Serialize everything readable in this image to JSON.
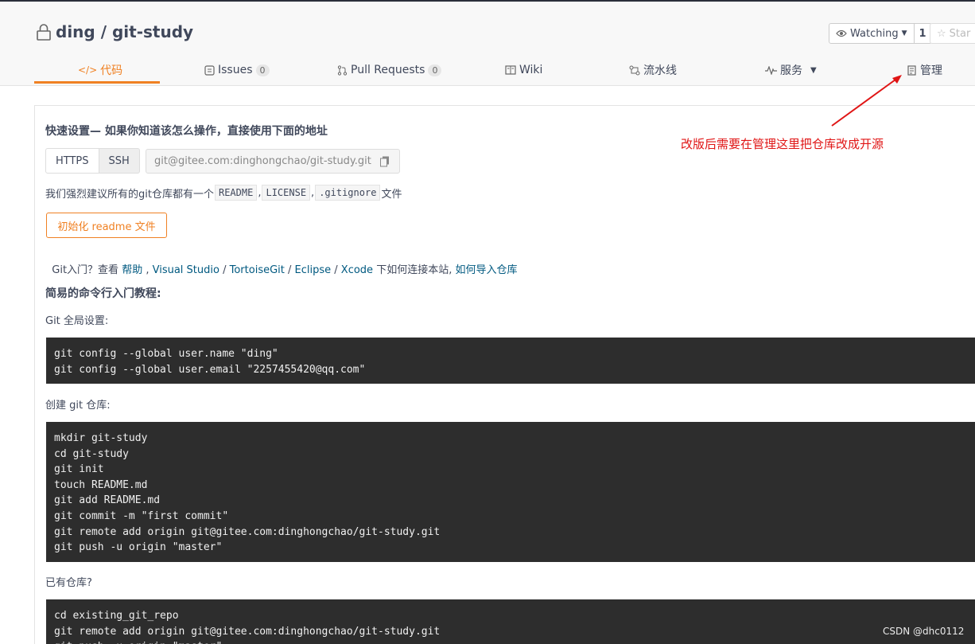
{
  "repo": {
    "owner": "ding",
    "separator": " / ",
    "name": "git-study"
  },
  "watch": {
    "label": "Watching",
    "count": "1"
  },
  "star": {
    "label": "Star"
  },
  "tabs": [
    {
      "label": "代码"
    },
    {
      "label": "Issues",
      "badge": "0"
    },
    {
      "label": "Pull Requests",
      "badge": "0"
    },
    {
      "label": "Wiki"
    },
    {
      "label": "流水线"
    },
    {
      "label": "服务"
    },
    {
      "label": "管理"
    }
  ],
  "quick_setup": {
    "title": "快速设置— 如果你知道该怎么操作，直接使用下面的地址",
    "https_label": "HTTPS",
    "ssh_label": "SSH",
    "url": "git@gitee.com:dinghongchao/git-study.git"
  },
  "recommend": {
    "prefix": "我们强烈建议所有的git仓库都有一个",
    "readme": "README",
    "sep1": ",",
    "license": "LICENSE",
    "sep2": ",",
    "gitignore": ".gitignore",
    "suffix": "文件"
  },
  "init_button": "初始化 readme 文件",
  "help": {
    "prefix": "Git入门？查看 ",
    "help_link": "帮助",
    "sep1": " , ",
    "vs_link": "Visual Studio",
    "sep2": " / ",
    "tortoise_link": "TortoiseGit",
    "sep3": " / ",
    "eclipse_link": "Eclipse",
    "sep4": " / ",
    "xcode_link": "Xcode",
    "middle": " 下如何连接本站, ",
    "import_link": "如何导入仓库"
  },
  "tutorial": {
    "title": "简易的命令行入门教程:",
    "global_label": "Git 全局设置:",
    "global_code": "git config --global user.name \"ding\"\ngit config --global user.email \"2257455420@qq.com\"",
    "create_label": "创建 git 仓库:",
    "create_code": "mkdir git-study\ncd git-study\ngit init\ntouch README.md\ngit add README.md\ngit commit -m \"first commit\"\ngit remote add origin git@gitee.com:dinghongchao/git-study.git\ngit push -u origin \"master\"",
    "existing_label": "已有仓库?",
    "existing_code": "cd existing_git_repo\ngit remote add origin git@gitee.com:dinghongchao/git-study.git\ngit push -u origin \"master\""
  },
  "annotation": "改版后需要在管理这里把仓库改成开源",
  "watermark": "CSDN @dhc0112",
  "colors": {
    "accent": "#f08123",
    "link": "#005980",
    "annotation": "#e01515",
    "code_bg": "#2d2d2d"
  }
}
